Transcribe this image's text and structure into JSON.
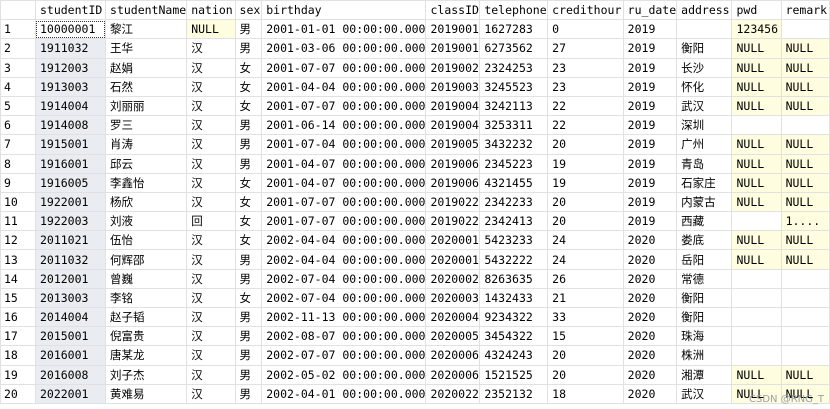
{
  "columns": [
    "studentID",
    "studentName",
    "nation",
    "sex",
    "birthday",
    "classID",
    "telephone",
    "credithour",
    "ru_date",
    "address",
    "pwd",
    "remark"
  ],
  "rows": [
    {
      "n": "1",
      "c": [
        "10000001",
        "黎江",
        "NULL",
        "男",
        "2001-01-01 00:00:00.000",
        "2019001",
        "1627283",
        "0",
        "2019",
        "",
        "123456",
        ""
      ]
    },
    {
      "n": "2",
      "c": [
        "1911032",
        "王华",
        "汉",
        "男",
        "2001-03-06 00:00:00.000",
        "2019001",
        "6273562",
        "27",
        "2019",
        "衡阳",
        "NULL",
        "NULL"
      ]
    },
    {
      "n": "3",
      "c": [
        "1912003",
        "赵娟",
        "汉",
        "女",
        "2001-07-07 00:00:00.000",
        "2019002",
        "2324253",
        "23",
        "2019",
        "长沙",
        "NULL",
        "NULL"
      ]
    },
    {
      "n": "4",
      "c": [
        "1913003",
        "石然",
        "汉",
        "女",
        "2001-04-04 00:00:00.000",
        "2019003",
        "3245523",
        "23",
        "2019",
        "怀化",
        "NULL",
        "NULL"
      ]
    },
    {
      "n": "5",
      "c": [
        "1914004",
        "刘丽丽",
        "汉",
        "女",
        "2001-07-07 00:00:00.000",
        "2019004",
        "3242113",
        "22",
        "2019",
        "武汉",
        "NULL",
        "NULL"
      ]
    },
    {
      "n": "6",
      "c": [
        "1914008",
        "罗三",
        "汉",
        "男",
        "2001-06-14 00:00:00.000",
        "2019004",
        "3253311",
        "22",
        "2019",
        "深圳",
        "",
        ""
      ]
    },
    {
      "n": "7",
      "c": [
        "1915001",
        "肖涛",
        "汉",
        "男",
        "2001-07-04 00:00:00.000",
        "2019005",
        "3432232",
        "20",
        "2019",
        "广州",
        "NULL",
        "NULL"
      ]
    },
    {
      "n": "8",
      "c": [
        "1916001",
        "邱云",
        "汉",
        "男",
        "2001-04-07 00:00:00.000",
        "2019006",
        "2345223",
        "19",
        "2019",
        "青岛",
        "NULL",
        "NULL"
      ]
    },
    {
      "n": "9",
      "c": [
        "1916005",
        "李鑫怡",
        "汉",
        "女",
        "2001-04-07 00:00:00.000",
        "2019006",
        "4321455",
        "19",
        "2019",
        "石家庄",
        "NULL",
        "NULL"
      ]
    },
    {
      "n": "10",
      "c": [
        "1922001",
        "杨欣",
        "汉",
        "女",
        "2001-07-07 00:00:00.000",
        "2019022",
        "2342233",
        "20",
        "2019",
        "内蒙古",
        "NULL",
        "NULL"
      ]
    },
    {
      "n": "11",
      "c": [
        "1922003",
        "刘液",
        "回",
        "女",
        "2001-07-07 00:00:00.000",
        "2019022",
        "2342413",
        "20",
        "2019",
        "西藏",
        "",
        "1...."
      ]
    },
    {
      "n": "12",
      "c": [
        "2011021",
        "伍怡",
        "汉",
        "女",
        "2002-04-04 00:00:00.000",
        "2020001",
        "5423233",
        "24",
        "2020",
        "娄底",
        "NULL",
        "NULL"
      ]
    },
    {
      "n": "13",
      "c": [
        "2011032",
        "何辉邵",
        "汉",
        "男",
        "2002-04-04 00:00:00.000",
        "2020001",
        "5432222",
        "24",
        "2020",
        "岳阳",
        "NULL",
        "NULL"
      ]
    },
    {
      "n": "14",
      "c": [
        "2012001",
        "曾巍",
        "汉",
        "男",
        "2002-07-04 00:00:00.000",
        "2020002",
        "8263635",
        "26",
        "2020",
        "常德",
        "",
        ""
      ]
    },
    {
      "n": "15",
      "c": [
        "2013003",
        "李铭",
        "汉",
        "女",
        "2002-07-04 00:00:00.000",
        "2020003",
        "1432433",
        "21",
        "2020",
        "衡阳",
        "",
        ""
      ]
    },
    {
      "n": "16",
      "c": [
        "2014004",
        "赵子韬",
        "汉",
        "男",
        "2002-11-13 00:00:00.000",
        "2020004",
        "9234322",
        "33",
        "2020",
        "衡阳",
        "",
        ""
      ]
    },
    {
      "n": "17",
      "c": [
        "2015001",
        "倪富贵",
        "汉",
        "男",
        "2002-08-07 00:00:00.000",
        "2020005",
        "3454322",
        "15",
        "2020",
        "珠海",
        "",
        ""
      ]
    },
    {
      "n": "18",
      "c": [
        "2016001",
        "唐某龙",
        "汉",
        "男",
        "2002-07-07 00:00:00.000",
        "2020006",
        "4324243",
        "20",
        "2020",
        "株洲",
        "",
        ""
      ]
    },
    {
      "n": "19",
      "c": [
        "2016008",
        "刘子杰",
        "汉",
        "男",
        "2002-05-02 00:00:00.000",
        "2020006",
        "1521525",
        "20",
        "2020",
        "湘潭",
        "NULL",
        "NULL"
      ]
    },
    {
      "n": "20",
      "c": [
        "2022001",
        "黄难易",
        "汉",
        "男",
        "2002-04-01 00:00:00.000",
        "2020022",
        "2352132",
        "18",
        "2020",
        "武汉",
        "NULL",
        "NULL"
      ]
    }
  ],
  "watermark": "CSDN @RNG_T"
}
